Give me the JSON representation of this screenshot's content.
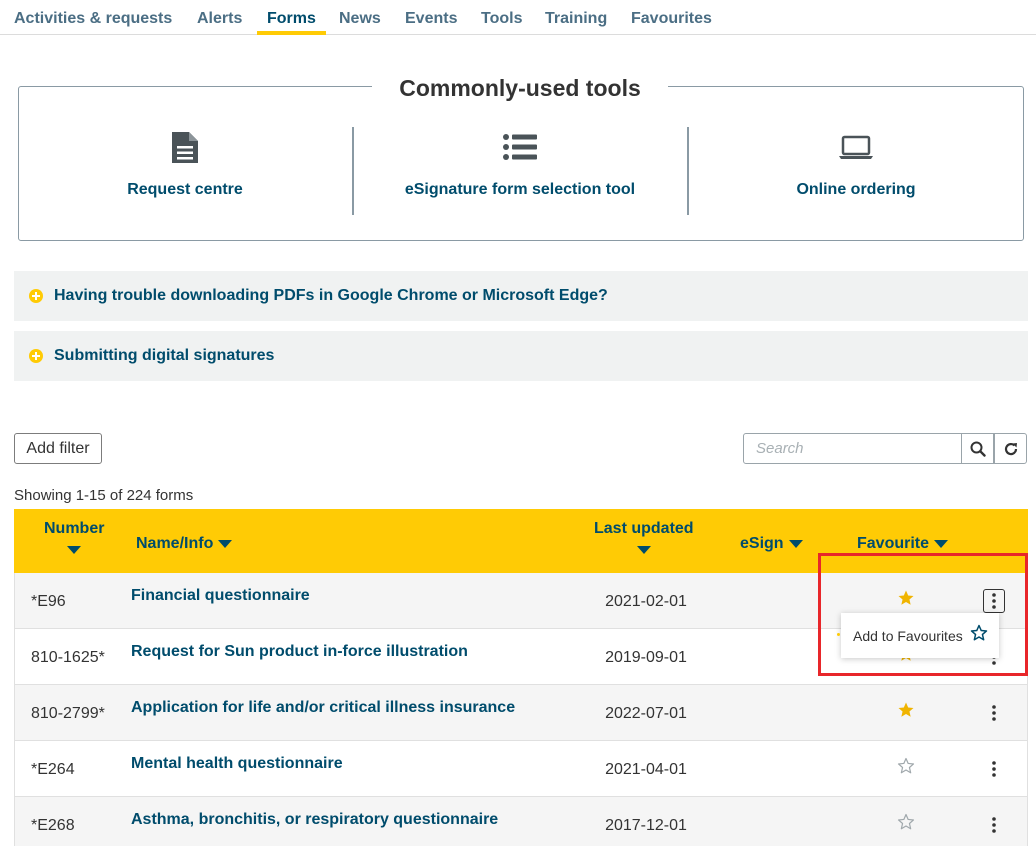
{
  "nav": {
    "tabs": [
      {
        "label": "Activities & requests"
      },
      {
        "label": "Alerts"
      },
      {
        "label": "Forms"
      },
      {
        "label": "News"
      },
      {
        "label": "Events"
      },
      {
        "label": "Tools"
      },
      {
        "label": "Training"
      },
      {
        "label": "Favourites"
      }
    ],
    "active": "Forms"
  },
  "tools": {
    "title": "Commonly-used tools",
    "items": [
      {
        "label": "Request centre",
        "icon": "document-icon"
      },
      {
        "label": "eSignature form selection tool",
        "icon": "list-icon"
      },
      {
        "label": "Online ordering",
        "icon": "laptop-icon"
      }
    ]
  },
  "accordions": [
    {
      "label": "Having trouble downloading PDFs in Google Chrome or Microsoft Edge?"
    },
    {
      "label": "Submitting digital signatures"
    }
  ],
  "filter": {
    "add_filter_label": "Add filter"
  },
  "search": {
    "placeholder": "Search"
  },
  "showing": "Showing 1-15 of 224 forms",
  "table": {
    "headers": {
      "number": "Number",
      "name": "Name/Info",
      "last_updated": "Last updated",
      "esign": "eSign",
      "favourite": "Favourite"
    },
    "rows": [
      {
        "number": "*E96",
        "name": "Financial questionnaire",
        "date": "2021-02-01",
        "favourite": true
      },
      {
        "number": "810-1625*",
        "name": "Request for Sun product in-force illustration",
        "date": "2019-09-01",
        "favourite": true
      },
      {
        "number": "810-2799*",
        "name": "Application for life and/or critical illness insurance",
        "date": "2022-07-01",
        "favourite": true
      },
      {
        "number": "*E264",
        "name": "Mental health questionnaire",
        "date": "2021-04-01",
        "favourite": false
      },
      {
        "number": "*E268",
        "name": "Asthma, bronchitis, or respiratory questionnaire",
        "date": "2017-12-01",
        "favourite": false
      }
    ]
  },
  "popup": {
    "label": "Add to Favourites",
    "icon": "star-outline-icon"
  },
  "colors": {
    "accent": "#ffcb05",
    "text_primary": "#004c6c",
    "highlight": "#e8262a",
    "accordion_bg": "#f0f2f2"
  }
}
